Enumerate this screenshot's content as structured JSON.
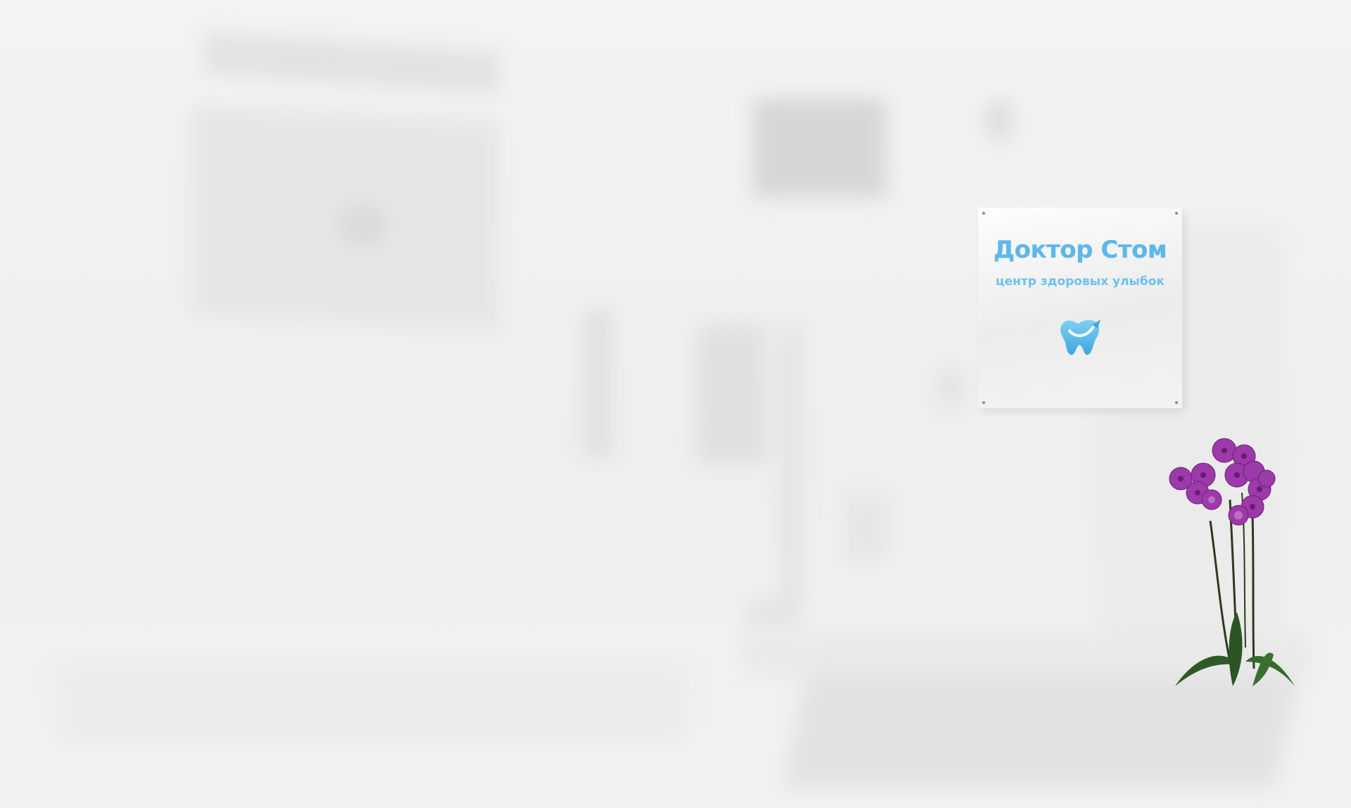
{
  "sign": {
    "brand_name": "Доктор Стом",
    "tagline": "центр здоровых улыбок",
    "logo_icon": "tooth-icon",
    "brand_color": "#5cb8ea"
  },
  "decor": {
    "plant_icon": "orchid-plant",
    "flower_color": "#9b3aa8"
  },
  "background": {
    "color": "#f0f0f0"
  }
}
